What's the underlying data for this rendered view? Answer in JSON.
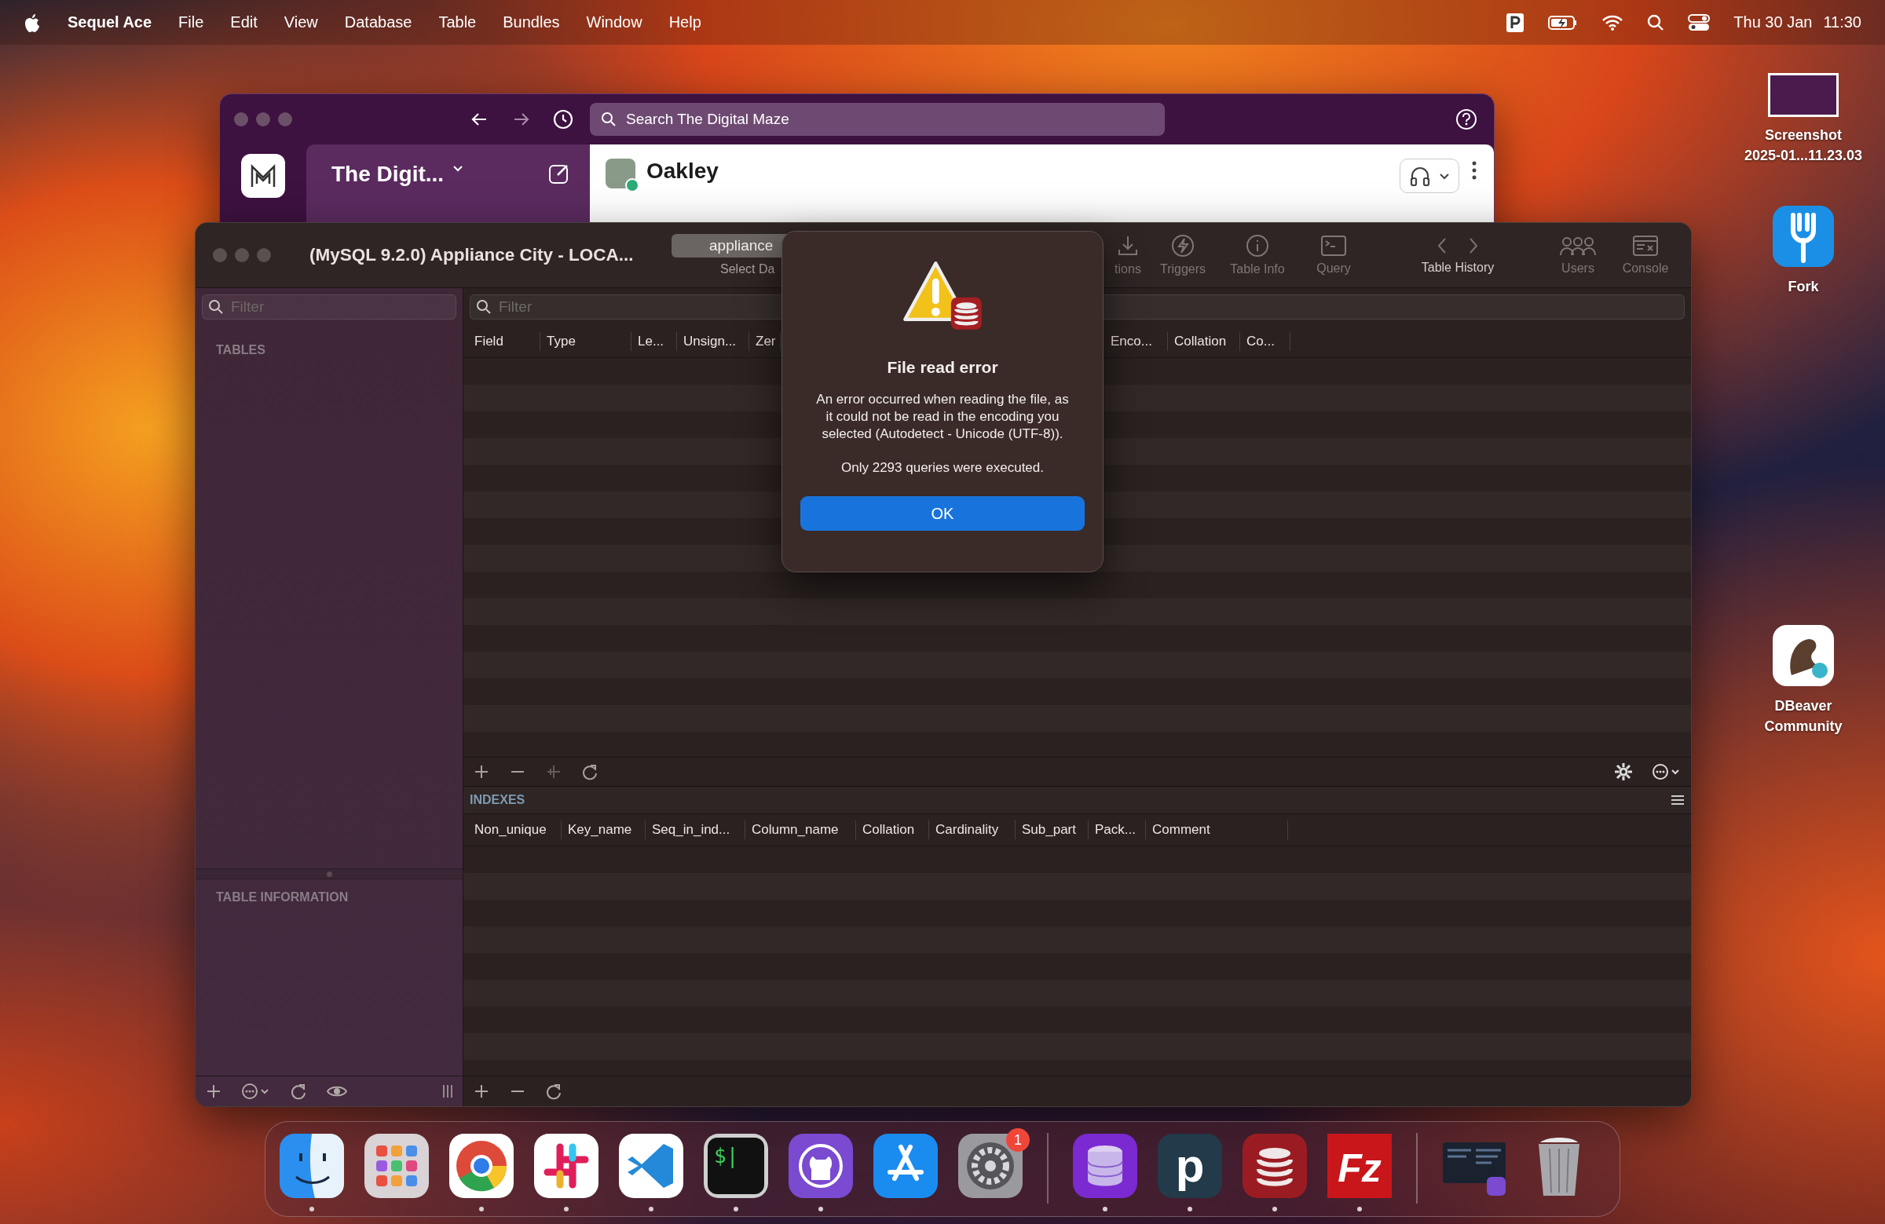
{
  "menu_bar": {
    "app_name": "Sequel Ace",
    "menus": [
      "File",
      "Edit",
      "View",
      "Database",
      "Table",
      "Bundles",
      "Window",
      "Help"
    ],
    "date": "Thu 30 Jan",
    "time": "11:30"
  },
  "slack_window": {
    "search": {
      "placeholder": "Search The Digital Maze"
    },
    "workspace": "The Digit...",
    "conversation": "Oakley",
    "online": true
  },
  "sequel_window": {
    "title": "(MySQL 9.2.0) Appliance City - LOCA...",
    "database_popup": "appliance",
    "database_label": "Select Da",
    "toolbar": [
      {
        "kind": "relations",
        "label": "tions",
        "disabled": true
      },
      {
        "kind": "triggers",
        "label": "Triggers",
        "disabled": true
      },
      {
        "kind": "table_info",
        "label": "Table Info",
        "disabled": true
      },
      {
        "kind": "query",
        "label": "Query",
        "disabled": true
      },
      {
        "kind": "history",
        "label": "Table History",
        "disabled": false
      },
      {
        "kind": "users",
        "label": "Users",
        "disabled": true
      },
      {
        "kind": "console",
        "label": "Console",
        "disabled": true
      }
    ],
    "sidebar": {
      "filter": {
        "placeholder": "Filter"
      },
      "tables_heading": "TABLES",
      "info_heading": "TABLE INFORMATION"
    },
    "structure": {
      "filter": {
        "placeholder": "Filter"
      },
      "columns_left": [
        "Field",
        "Type",
        "Le...",
        "Unsign...",
        "Zer"
      ],
      "columns_right": [
        "Enco...",
        "Collation",
        "Co..."
      ]
    },
    "indexes": {
      "heading": "INDEXES",
      "columns": [
        "Non_unique",
        "Key_name",
        "Seq_in_ind...",
        "Column_name",
        "Collation",
        "Cardinality",
        "Sub_part",
        "Pack...",
        "Comment"
      ]
    }
  },
  "dialog": {
    "title": "File read error",
    "message": "An error occurred when reading the file, as it could not be read in the encoding you selected (Autodetect - Unicode (UTF-8)).",
    "detail": "Only 2293 queries were executed.",
    "button": "OK"
  },
  "desktop_icons": [
    {
      "kind": "screenshot",
      "label_lines": [
        "Screenshot",
        "2025-01...11.23.03"
      ]
    },
    {
      "kind": "fork",
      "label_lines": [
        "Fork"
      ]
    },
    {
      "kind": "dbeaver",
      "label_lines": [
        "DBeaver",
        "Community"
      ]
    }
  ],
  "dock": {
    "sections": [
      {
        "apps": [
          {
            "kind": "finder",
            "running": true
          },
          {
            "kind": "launchpad",
            "running": false
          },
          {
            "kind": "chrome",
            "running": true
          },
          {
            "kind": "slack",
            "running": true
          },
          {
            "kind": "vscode",
            "running": true
          },
          {
            "kind": "terminal",
            "glyph": "$|",
            "running": true
          },
          {
            "kind": "github",
            "running": true
          },
          {
            "kind": "appstore",
            "running": false
          },
          {
            "kind": "settings",
            "badge": "1",
            "running": false
          }
        ]
      },
      {
        "apps": [
          {
            "kind": "db_purple",
            "running": true
          },
          {
            "kind": "letter",
            "glyph": "p",
            "running": true
          },
          {
            "kind": "db_red",
            "running": true
          },
          {
            "kind": "filezilla",
            "glyph": "Fz",
            "running": true
          }
        ]
      },
      {
        "apps": [
          {
            "kind": "window_thumb",
            "running": false
          },
          {
            "kind": "trash",
            "running": false
          }
        ]
      }
    ]
  }
}
